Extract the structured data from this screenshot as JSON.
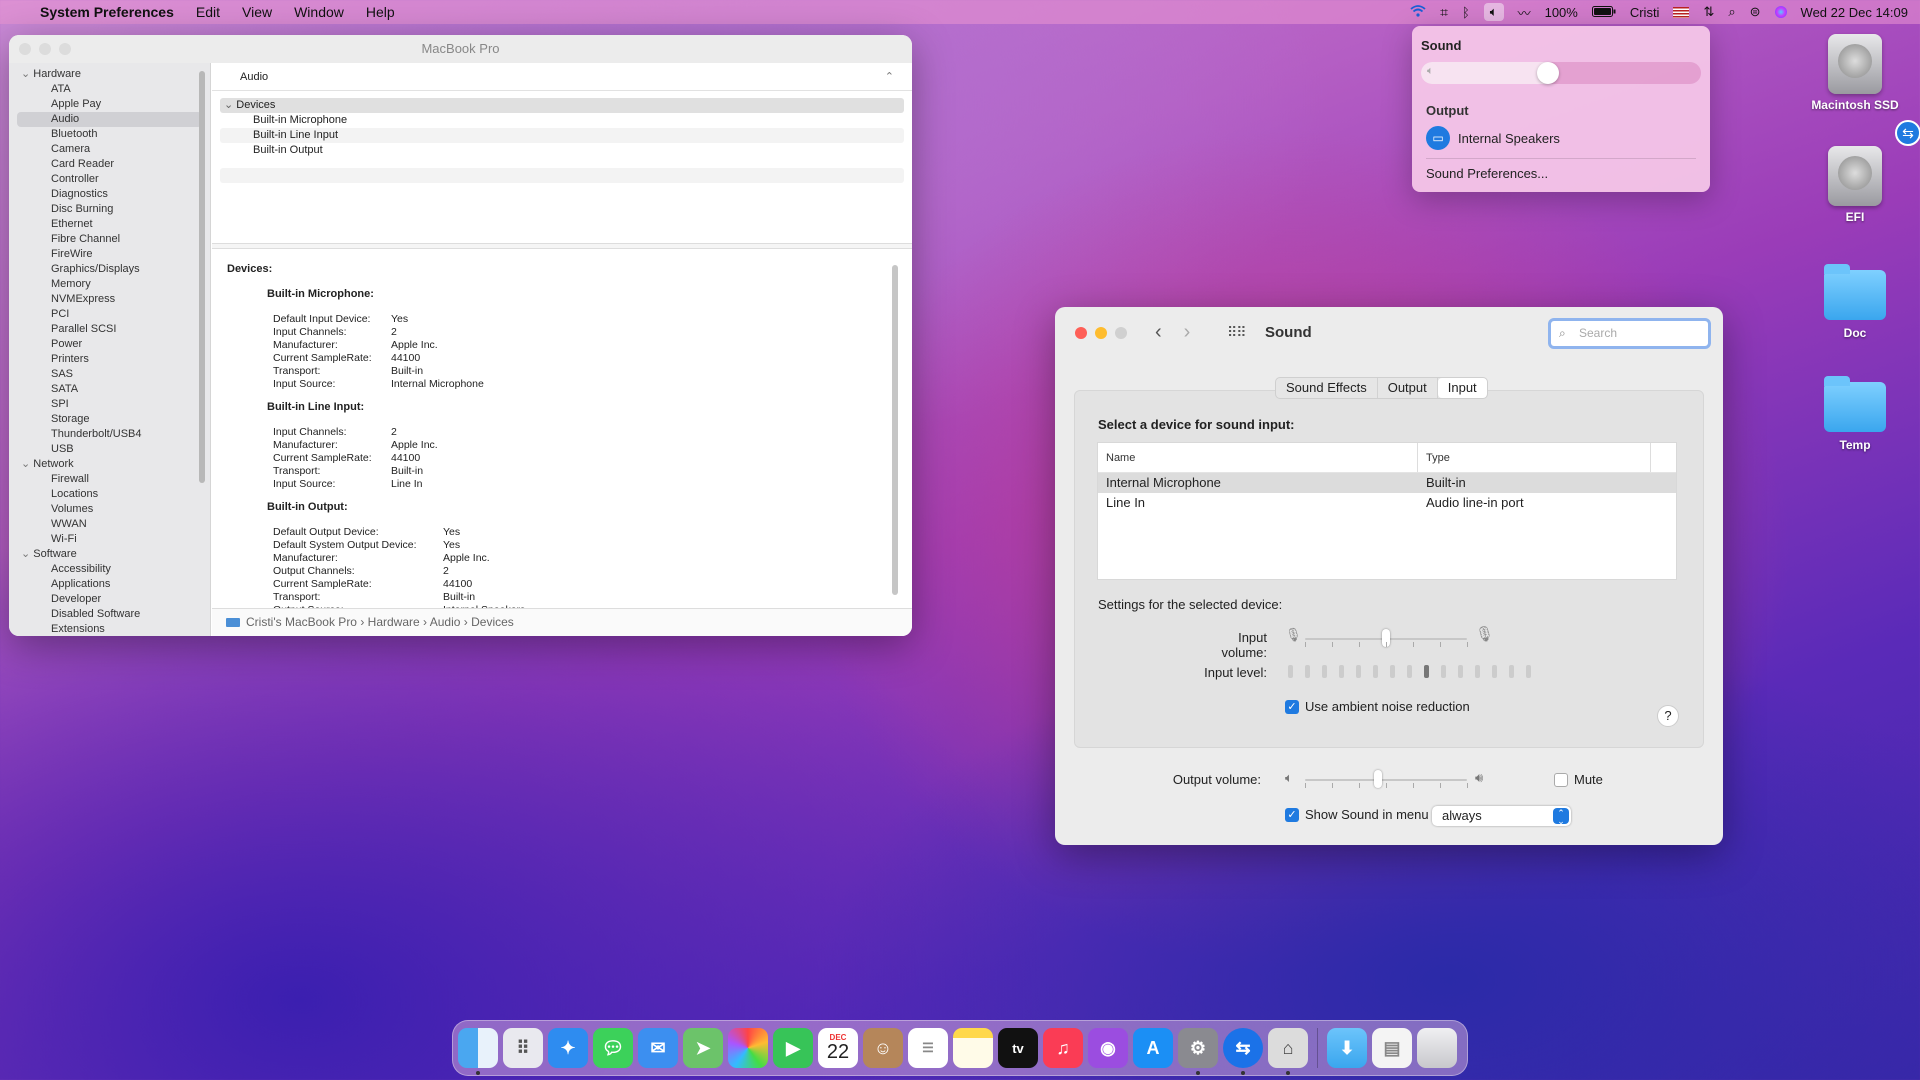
{
  "menubar": {
    "app": "System Preferences",
    "menus": [
      "Edit",
      "View",
      "Window",
      "Help"
    ],
    "battery": "100%",
    "user": "Cristi",
    "datetime": "Wed 22 Dec  14:09"
  },
  "sysinfo": {
    "title": "MacBook Pro",
    "sidebar": [
      {
        "type": "cat",
        "label": "Hardware"
      },
      {
        "type": "it",
        "label": "ATA"
      },
      {
        "type": "it",
        "label": "Apple Pay"
      },
      {
        "type": "it",
        "label": "Audio",
        "active": true
      },
      {
        "type": "it",
        "label": "Bluetooth"
      },
      {
        "type": "it",
        "label": "Camera"
      },
      {
        "type": "it",
        "label": "Card Reader"
      },
      {
        "type": "it",
        "label": "Controller"
      },
      {
        "type": "it",
        "label": "Diagnostics"
      },
      {
        "type": "it",
        "label": "Disc Burning"
      },
      {
        "type": "it",
        "label": "Ethernet"
      },
      {
        "type": "it",
        "label": "Fibre Channel"
      },
      {
        "type": "it",
        "label": "FireWire"
      },
      {
        "type": "it",
        "label": "Graphics/Displays"
      },
      {
        "type": "it",
        "label": "Memory"
      },
      {
        "type": "it",
        "label": "NVMExpress"
      },
      {
        "type": "it",
        "label": "PCI"
      },
      {
        "type": "it",
        "label": "Parallel SCSI"
      },
      {
        "type": "it",
        "label": "Power"
      },
      {
        "type": "it",
        "label": "Printers"
      },
      {
        "type": "it",
        "label": "SAS"
      },
      {
        "type": "it",
        "label": "SATA"
      },
      {
        "type": "it",
        "label": "SPI"
      },
      {
        "type": "it",
        "label": "Storage"
      },
      {
        "type": "it",
        "label": "Thunderbolt/USB4"
      },
      {
        "type": "it",
        "label": "USB"
      },
      {
        "type": "cat",
        "label": "Network"
      },
      {
        "type": "it",
        "label": "Firewall"
      },
      {
        "type": "it",
        "label": "Locations"
      },
      {
        "type": "it",
        "label": "Volumes"
      },
      {
        "type": "it",
        "label": "WWAN"
      },
      {
        "type": "it",
        "label": "Wi-Fi"
      },
      {
        "type": "cat",
        "label": "Software"
      },
      {
        "type": "it",
        "label": "Accessibility"
      },
      {
        "type": "it",
        "label": "Applications"
      },
      {
        "type": "it",
        "label": "Developer"
      },
      {
        "type": "it",
        "label": "Disabled Software"
      },
      {
        "type": "it",
        "label": "Extensions"
      }
    ],
    "header": "Audio",
    "devices_label": "Devices",
    "devices": [
      "Built-in Microphone",
      "Built-in Line Input",
      "Built-in Output"
    ],
    "detail_title": "Devices:",
    "sections": [
      {
        "name": "Built-in Microphone:",
        "wide": false,
        "rows": [
          [
            "Default Input Device:",
            "Yes"
          ],
          [
            "Input Channels:",
            "2"
          ],
          [
            "Manufacturer:",
            "Apple Inc."
          ],
          [
            "Current SampleRate:",
            "44100"
          ],
          [
            "Transport:",
            "Built-in"
          ],
          [
            "Input Source:",
            "Internal Microphone"
          ]
        ]
      },
      {
        "name": "Built-in Line Input:",
        "wide": false,
        "rows": [
          [
            "Input Channels:",
            "2"
          ],
          [
            "Manufacturer:",
            "Apple Inc."
          ],
          [
            "Current SampleRate:",
            "44100"
          ],
          [
            "Transport:",
            "Built-in"
          ],
          [
            "Input Source:",
            "Line In"
          ]
        ]
      },
      {
        "name": "Built-in Output:",
        "wide": true,
        "rows": [
          [
            "Default Output Device:",
            "Yes"
          ],
          [
            "Default System Output Device:",
            "Yes"
          ],
          [
            "Manufacturer:",
            "Apple Inc."
          ],
          [
            "Output Channels:",
            "2"
          ],
          [
            "Current SampleRate:",
            "44100"
          ],
          [
            "Transport:",
            "Built-in"
          ],
          [
            "Output Source:",
            "Internal Speakers"
          ]
        ]
      }
    ],
    "breadcrumb": [
      "Cristi's MacBook Pro",
      "Hardware",
      "Audio",
      "Devices"
    ]
  },
  "popup": {
    "title": "Sound",
    "volume_fraction": 0.45,
    "output_label": "Output",
    "device": "Internal Speakers",
    "prefs_link": "Sound Preferences..."
  },
  "sound": {
    "title": "Sound",
    "search_placeholder": "Search",
    "tabs": [
      "Sound Effects",
      "Output",
      "Input"
    ],
    "active_tab": "Input",
    "select_label": "Select a device for sound input:",
    "columns": [
      "Name",
      "Type"
    ],
    "rows": [
      {
        "name": "Internal Microphone",
        "type": "Built-in",
        "selected": true
      },
      {
        "name": "Line In",
        "type": "Audio line-in port",
        "selected": false
      }
    ],
    "settings_label": "Settings for the selected device:",
    "input_volume_label": "Input volume:",
    "input_volume_fraction": 0.5,
    "input_level_label": "Input level:",
    "input_level_active_index": 8,
    "ambient_label": "Use ambient noise reduction",
    "ambient_checked": true,
    "help": "?",
    "output_volume_label": "Output volume:",
    "output_volume_fraction": 0.45,
    "mute_label": "Mute",
    "mute_checked": false,
    "show_menu_label": "Show Sound in menu bar",
    "show_menu_checked": true,
    "show_menu_value": "always"
  },
  "desktop": [
    {
      "label": "Macintosh SSD",
      "kind": "disk"
    },
    {
      "label": "EFI",
      "kind": "disk"
    },
    {
      "label": "Doc",
      "kind": "folder"
    },
    {
      "label": "Temp",
      "kind": "folder"
    }
  ],
  "dock": {
    "calendar_month": "DEC",
    "calendar_day": "22",
    "tv_label": "tv"
  }
}
